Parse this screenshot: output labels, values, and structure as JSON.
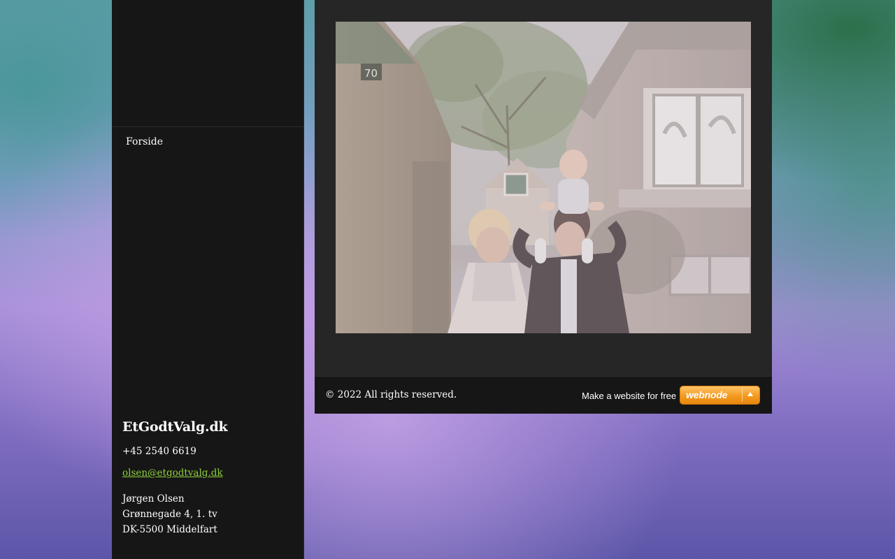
{
  "nav": {
    "items": [
      {
        "label": "Forside"
      }
    ]
  },
  "contact": {
    "site_title": "EtGodtValg.dk",
    "phone": "+45 2540 6619",
    "email": "olsen@etgodtvalg.dk",
    "address": {
      "name": "Jørgen Olsen",
      "street": "Grønnegade 4, 1. tv",
      "city": "DK-5500 Middelfart"
    }
  },
  "photo": {
    "house_number": "70"
  },
  "footer": {
    "copyright": "© 2022 All rights reserved.",
    "make_site_label": "Make a website for free",
    "badge_label": "webnode"
  },
  "colors": {
    "sidebar_bg": "#161616",
    "content_bg": "#262626",
    "link": "#8fd13a",
    "badge": "#f39a1e"
  }
}
